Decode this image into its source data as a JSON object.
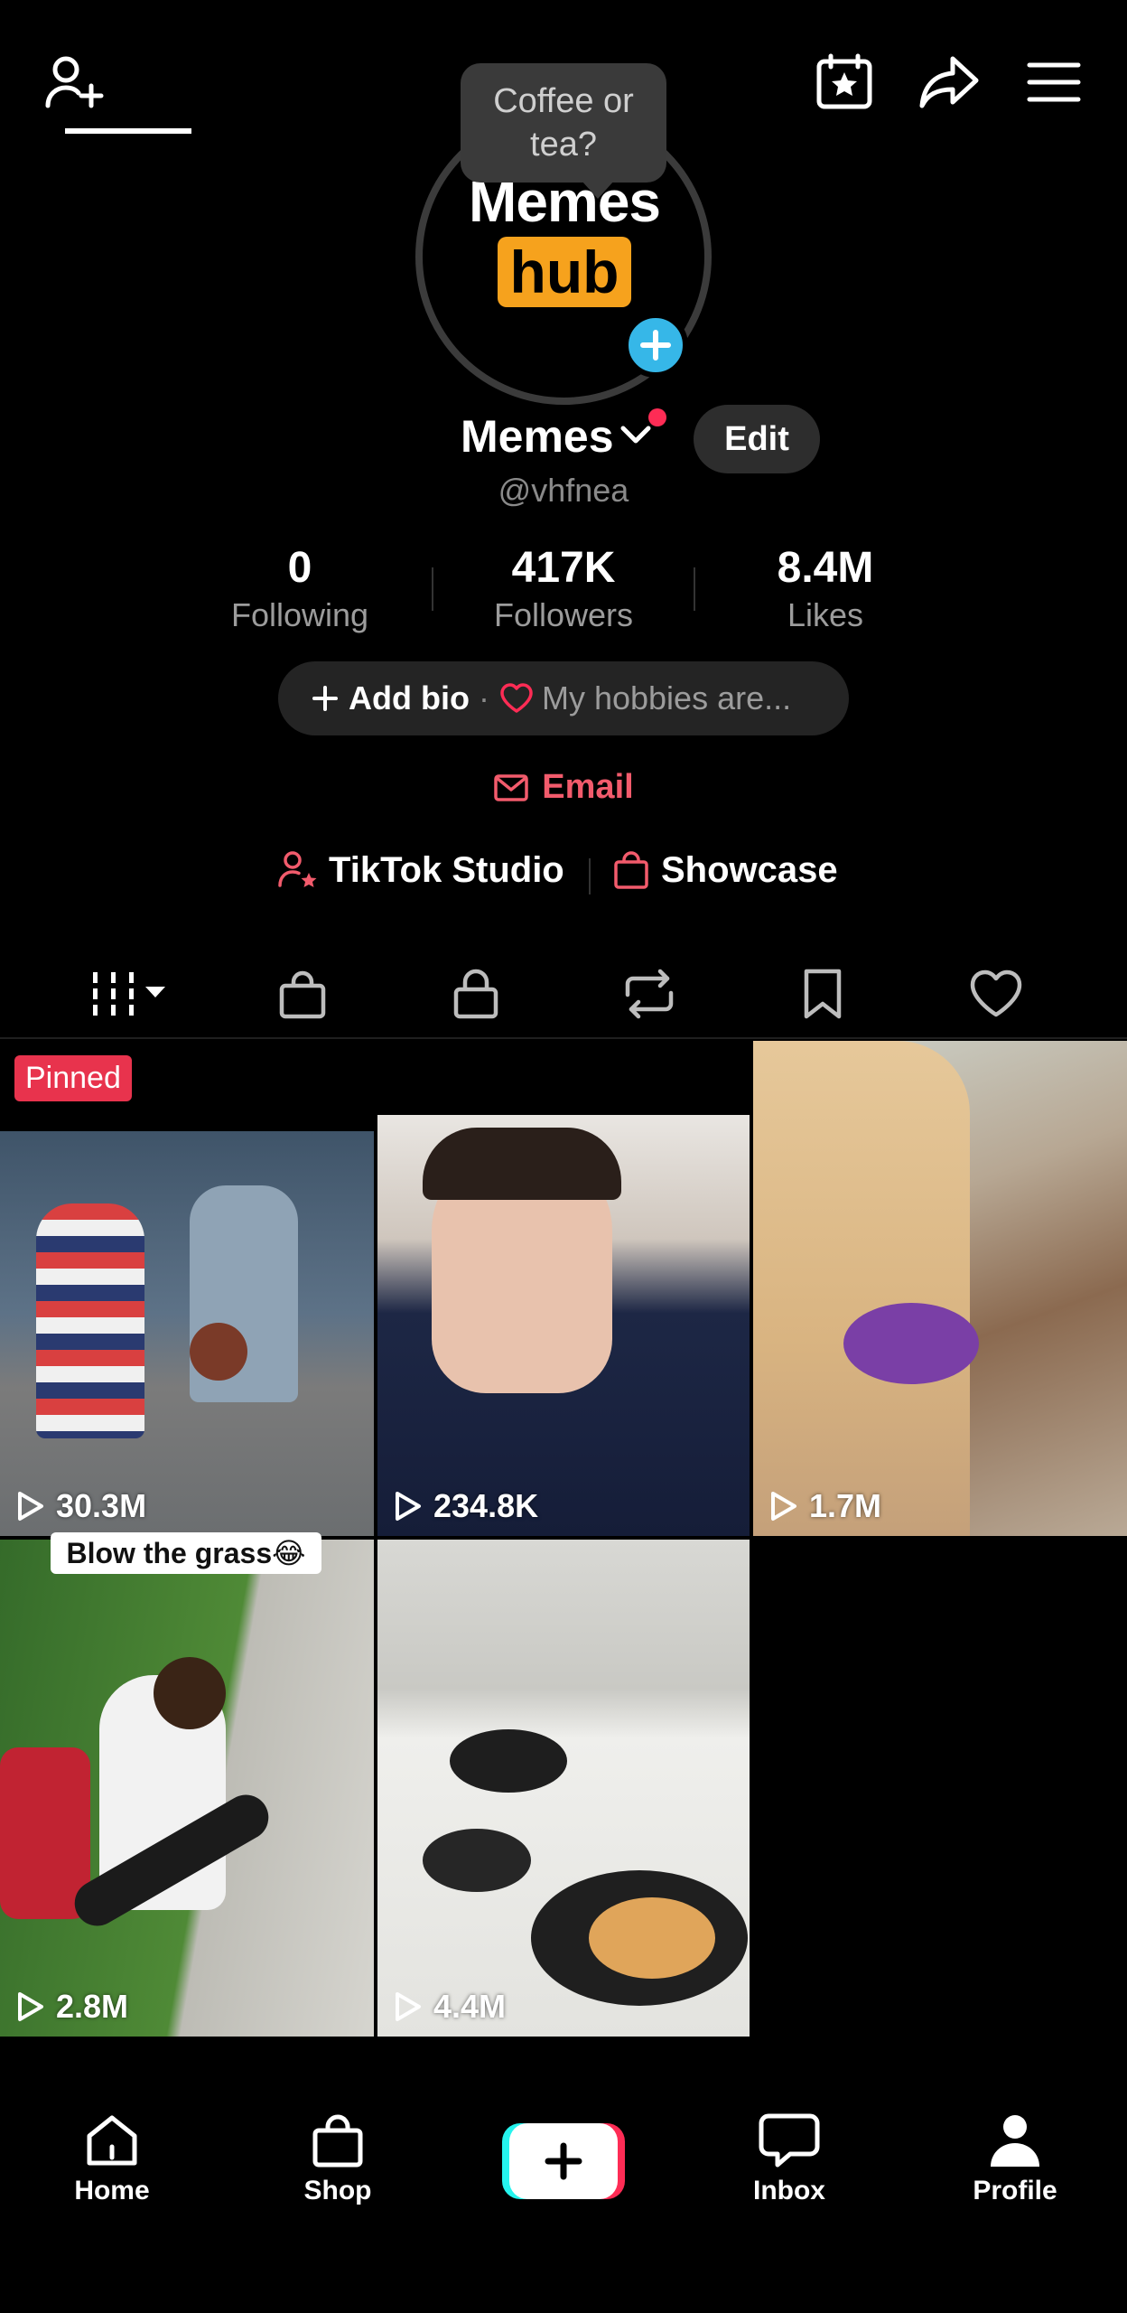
{
  "tooltip": {
    "text": "Coffee or tea?"
  },
  "avatar": {
    "logo_top": "Memes",
    "logo_bottom": "hub"
  },
  "profile": {
    "name": "Memes",
    "handle": "@vhfnea",
    "edit_label": "Edit"
  },
  "stats": [
    {
      "value": "0",
      "label": "Following"
    },
    {
      "value": "417K",
      "label": "Followers"
    },
    {
      "value": "8.4M",
      "label": "Likes"
    }
  ],
  "bio": {
    "add_label": "Add bio",
    "separator": "·",
    "hobbies": "My hobbies are..."
  },
  "email": {
    "label": "Email"
  },
  "links": {
    "studio": "TikTok Studio",
    "showcase": "Showcase"
  },
  "tabs": [
    "videos-grid",
    "shop",
    "private",
    "reposts",
    "favorites",
    "liked"
  ],
  "grid": {
    "pinned_label": "Pinned",
    "videos": [
      {
        "views": "30.3M"
      },
      {
        "views": "234.8K"
      },
      {
        "views": "1.7M"
      },
      {
        "views": "2.8M",
        "caption": "Blow the grass😂"
      },
      {
        "views": "4.4M"
      }
    ]
  },
  "nav": {
    "home": "Home",
    "shop": "Shop",
    "inbox": "Inbox",
    "profile": "Profile"
  },
  "colors": {
    "accent": "#fe2c55",
    "teal": "#25f4ee",
    "avatar_plus": "#36b7e8",
    "hub_orange": "#f6a21d"
  }
}
